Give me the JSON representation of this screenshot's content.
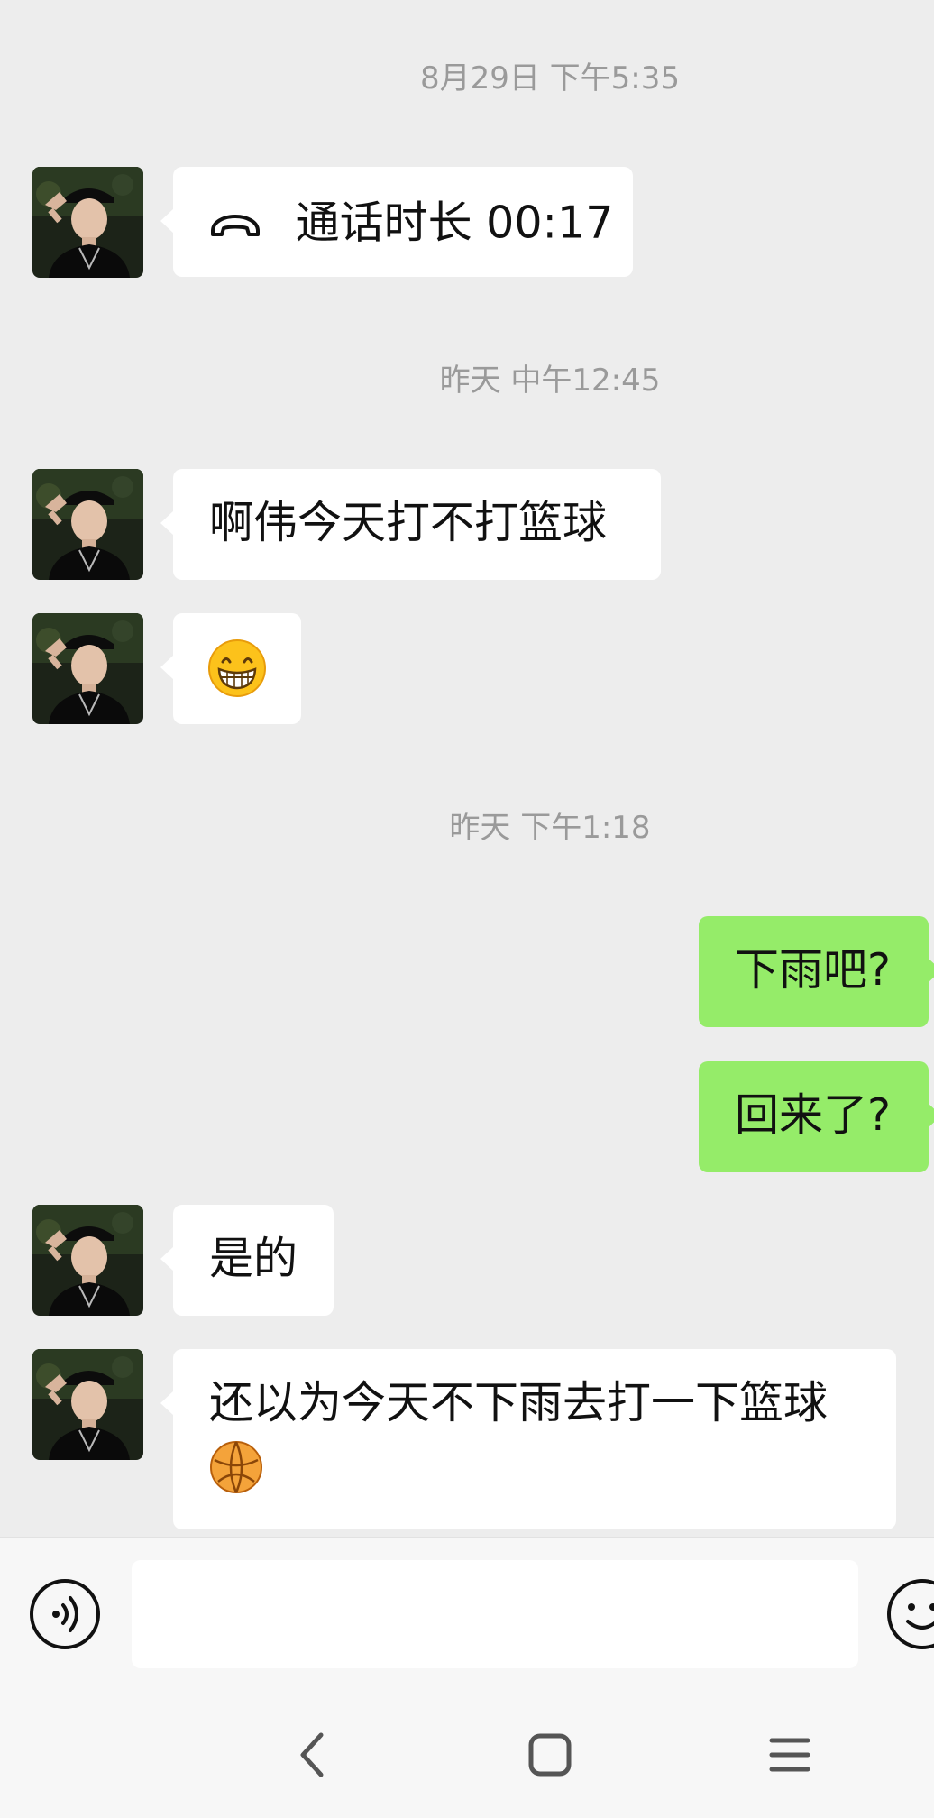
{
  "timestamps": [
    "8月29日 下午5:35",
    "昨天 中午12:45",
    "昨天 下午1:18"
  ],
  "call": {
    "label": "通话时长 00:17",
    "icon": "phone-hangup-icon"
  },
  "messages": {
    "m1": "啊伟今天打不打篮球",
    "m2_emoji": "grinning-face-emoji",
    "m3": "下雨吧?",
    "m4": "回来了?",
    "m5": "是的",
    "m6": "还以为今天不下雨去打一下篮球",
    "m6_emoji": "basketball-emoji"
  },
  "input": {
    "value": "",
    "placeholder": ""
  },
  "icons": {
    "voice": "voice-input-icon",
    "emoji": "emoji-button-icon",
    "back": "nav-back-icon",
    "home": "nav-home-icon",
    "menu": "nav-menu-icon"
  },
  "colors": {
    "background": "#ededed",
    "sent_bubble": "#95ec69",
    "received_bubble": "#ffffff"
  }
}
